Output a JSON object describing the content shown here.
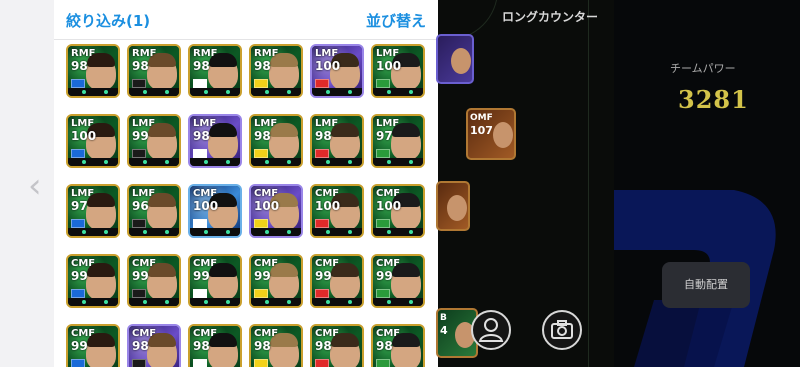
{
  "header": {
    "filter_label": "絞り込み(1)",
    "sort_label": "並び替え"
  },
  "field_title": "ロングカウンター",
  "team_power": {
    "label": "チームパワー",
    "value": "3281"
  },
  "auto_assign_label": "自動配置",
  "icons": {
    "back": "chevron-left-icon",
    "player": "user-icon",
    "camera": "camera-icon"
  },
  "players": [
    {
      "pos": "RMF",
      "ovr": "98",
      "theme": "green"
    },
    {
      "pos": "RMF",
      "ovr": "98",
      "theme": "green"
    },
    {
      "pos": "RMF",
      "ovr": "98",
      "theme": "green"
    },
    {
      "pos": "RMF",
      "ovr": "98",
      "theme": "green"
    },
    {
      "pos": "LMF",
      "ovr": "100",
      "theme": "purple"
    },
    {
      "pos": "LMF",
      "ovr": "100",
      "theme": "green"
    },
    {
      "pos": "LMF",
      "ovr": "100",
      "theme": "green"
    },
    {
      "pos": "LMF",
      "ovr": "99",
      "theme": "green"
    },
    {
      "pos": "LMF",
      "ovr": "98",
      "theme": "purple"
    },
    {
      "pos": "LMF",
      "ovr": "98",
      "theme": "green"
    },
    {
      "pos": "LMF",
      "ovr": "98",
      "theme": "green"
    },
    {
      "pos": "LMF",
      "ovr": "97",
      "theme": "green"
    },
    {
      "pos": "LMF",
      "ovr": "97",
      "theme": "green"
    },
    {
      "pos": "LMF",
      "ovr": "96",
      "theme": "green"
    },
    {
      "pos": "CMF",
      "ovr": "100",
      "theme": "blue"
    },
    {
      "pos": "CMF",
      "ovr": "100",
      "theme": "purple"
    },
    {
      "pos": "CMF",
      "ovr": "100",
      "theme": "green"
    },
    {
      "pos": "CMF",
      "ovr": "100",
      "theme": "green"
    },
    {
      "pos": "CMF",
      "ovr": "99",
      "theme": "green"
    },
    {
      "pos": "CMF",
      "ovr": "99",
      "theme": "green"
    },
    {
      "pos": "CMF",
      "ovr": "99",
      "theme": "green"
    },
    {
      "pos": "CMF",
      "ovr": "99",
      "theme": "green"
    },
    {
      "pos": "CMF",
      "ovr": "99",
      "theme": "green"
    },
    {
      "pos": "CMF",
      "ovr": "99",
      "theme": "green"
    },
    {
      "pos": "CMF",
      "ovr": "99",
      "theme": "green"
    },
    {
      "pos": "CMF",
      "ovr": "98",
      "theme": "purple"
    },
    {
      "pos": "CMF",
      "ovr": "98",
      "theme": "green"
    },
    {
      "pos": "CMF",
      "ovr": "98",
      "theme": "green"
    },
    {
      "pos": "CMF",
      "ovr": "98",
      "theme": "green"
    },
    {
      "pos": "CMF",
      "ovr": "98",
      "theme": "green"
    }
  ],
  "field_players": [
    {
      "pos": "",
      "ovr": ""
    },
    {
      "pos": "OMF",
      "ovr": "107"
    },
    {
      "pos": "",
      "ovr": ""
    },
    {
      "pos": "B",
      "ovr": "4"
    }
  ],
  "colors": {
    "accent": "#1b8fe0",
    "team_power": "#d3c34a",
    "card_border": "#caa02e"
  }
}
